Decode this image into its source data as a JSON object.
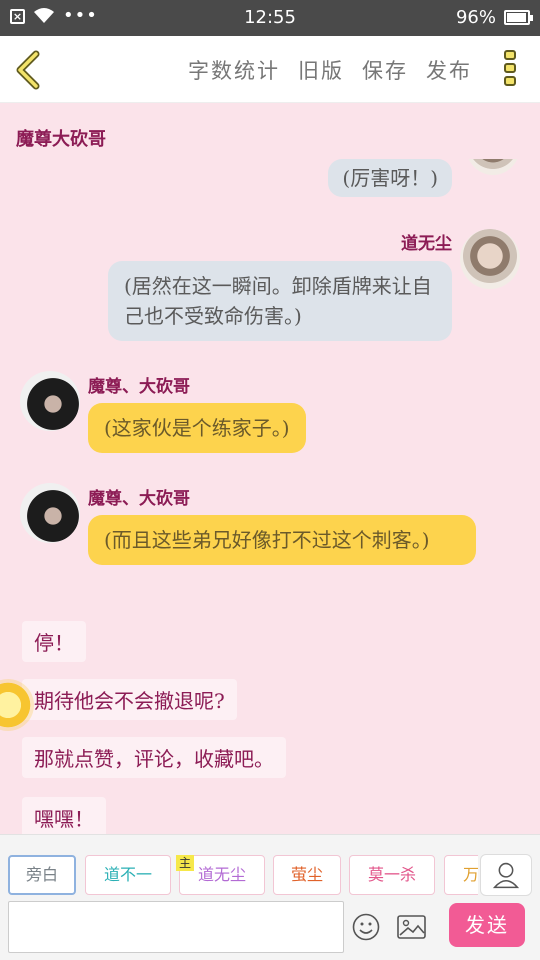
{
  "status_bar": {
    "time": "12:55",
    "battery": "96%",
    "battery_level": 0.96
  },
  "toolbar": {
    "word_count_label": "字数统计",
    "old_version_label": "旧版",
    "save_label": "保存",
    "publish_label": "发布"
  },
  "chat": {
    "title": "魔尊大砍哥",
    "messages": [
      {
        "text": "(厉害呀！)"
      },
      {
        "sender": "道无尘",
        "text": "(居然在这一瞬间。卸除盾牌来让自己也不受致命伤害。)"
      },
      {
        "sender": "魔尊、大砍哥",
        "text": "(这家伙是个练家子。)"
      },
      {
        "sender": "魔尊、大砍哥",
        "text": "(而且这些弟兄好像打不过这个刺客。)"
      }
    ],
    "narration": [
      "停！",
      "期待他会不会撤退呢?",
      "那就点赞，评论，收藏吧。",
      "嘿嘿！"
    ]
  },
  "roles": [
    {
      "label": "旁白",
      "color": "#7a8288"
    },
    {
      "label": "道不一",
      "color": "#2bb0b5"
    },
    {
      "label": "道无尘",
      "color": "#b36bd4"
    },
    {
      "label": "萤尘",
      "color": "#e0622a"
    },
    {
      "label": "莫一杀",
      "color": "#e2558a"
    },
    {
      "label": "万",
      "color": "#e0a030"
    }
  ],
  "main_role_tag": "主",
  "send_label": "发送",
  "colors": {
    "accent_pink": "#f25b95",
    "name_color": "#8c1c55",
    "bubble_yellow": "#fdd34d",
    "bubble_blue": "#dde3ea"
  },
  "icons": [
    "back-arrow-icon",
    "more-icon",
    "emoji-icon",
    "image-icon",
    "person-icon",
    "sun-icon",
    "wifi-icon",
    "battery-icon"
  ]
}
